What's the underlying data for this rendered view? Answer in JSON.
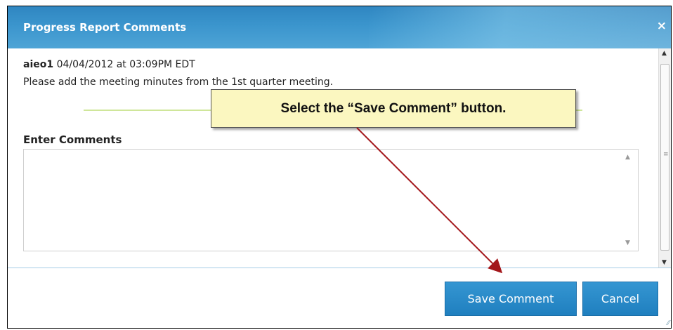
{
  "dialog": {
    "title": "Progress Report Comments",
    "close_icon": "×"
  },
  "comment": {
    "author": "aieo1",
    "timestamp": "04/04/2012 at 03:09PM EDT",
    "text": "Please add the meeting minutes from the 1st quarter meeting."
  },
  "entry": {
    "label": "Enter Comments",
    "value": ""
  },
  "buttons": {
    "save": "Save Comment",
    "cancel": "Cancel"
  },
  "callout": {
    "text": "Select the “Save Comment” button."
  },
  "colors": {
    "titlebar": "#2f86c1",
    "button": "#2a8ccc",
    "callout_bg": "#fbf7c0",
    "arrow": "#a3161a"
  }
}
